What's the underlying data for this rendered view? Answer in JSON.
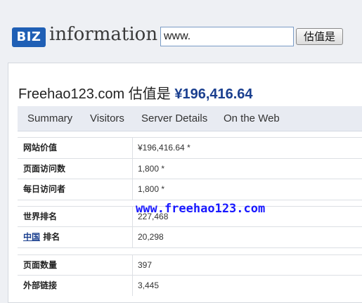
{
  "header": {
    "logo_badge": "BIZ",
    "logo_text": "information",
    "search_value": "www.",
    "search_button": "估值是"
  },
  "title": {
    "site": "Freehao123.com",
    "label": "估值是",
    "price": "¥196,416.64"
  },
  "tabs": [
    "Summary",
    "Visitors",
    "Server Details",
    "On the Web"
  ],
  "rows": {
    "site_value": {
      "label": "网站价值",
      "value": "¥196,416.64 *"
    },
    "page_views": {
      "label": "页面访问数",
      "value": "1,800 *"
    },
    "daily_visitors": {
      "label": "每日访问者",
      "value": "1,800 *"
    },
    "world_rank": {
      "label": "世界排名",
      "value": "227,468"
    },
    "china_rank": {
      "country": "中国",
      "label": "排名",
      "value": "20,298"
    },
    "page_count": {
      "label": "页面数量",
      "value": "397"
    },
    "external_links": {
      "label": "外部链接",
      "value": "3,445"
    }
  },
  "watermark": "www.freehao123.com"
}
